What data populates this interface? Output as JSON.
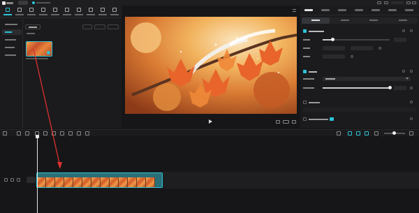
{
  "window": {
    "project_title": "",
    "app_logo_icon": "app-logo-icon",
    "menu_button_label": "",
    "autosave_status": ""
  },
  "media_toolbar": {
    "tools": [
      {
        "label": "",
        "icon": "media-icon",
        "active": true
      },
      {
        "label": "",
        "icon": "audio-icon"
      },
      {
        "label": "",
        "icon": "text-icon"
      },
      {
        "label": "",
        "icon": "sticker-icon"
      },
      {
        "label": "",
        "icon": "effects-icon"
      },
      {
        "label": "",
        "icon": "transition-icon"
      },
      {
        "label": "",
        "icon": "filter-icon"
      },
      {
        "label": "",
        "icon": "adjust-icon"
      },
      {
        "label": "",
        "icon": "template-icon"
      },
      {
        "label": "",
        "icon": "digital-human-icon"
      }
    ]
  },
  "media_sidebar": {
    "items": [
      {
        "label": "",
        "selected": false
      },
      {
        "label": "",
        "selected": true
      },
      {
        "label": "",
        "selected": false
      },
      {
        "label": "",
        "selected": false
      },
      {
        "label": "",
        "selected": false
      }
    ]
  },
  "media_content": {
    "import_label": "",
    "folder_label": "",
    "tools": [
      "",
      "",
      ""
    ],
    "items": [
      {
        "name": "",
        "has_badge": true
      }
    ]
  },
  "preview": {
    "title": "",
    "current_time": "",
    "total_time": "",
    "play_icon": "play-icon"
  },
  "properties": {
    "tabs": [
      {
        "label": "",
        "selected": true
      },
      {
        "label": ""
      },
      {
        "label": ""
      },
      {
        "label": ""
      },
      {
        "label": ""
      },
      {
        "label": ""
      },
      {
        "label": ""
      }
    ],
    "subtabs": [
      {
        "label": "",
        "selected": true
      },
      {
        "label": ""
      },
      {
        "label": ""
      },
      {
        "label": ""
      }
    ],
    "position_size": {
      "enabled": true,
      "scale_percent": "",
      "scale_level": 0.15,
      "x_value": "",
      "y_value": "",
      "rotation_value": ""
    },
    "blend": {
      "enabled": true,
      "mode_value": "",
      "opacity_percent": "",
      "opacity_level": 1.0
    },
    "stabilize": {
      "enabled": false
    },
    "smart_enhance": {
      "enabled": false
    }
  },
  "timeline": {
    "ruler_ticks": [
      "",
      "",
      "",
      "",
      "",
      "",
      "",
      "",
      ""
    ],
    "cover_label": "",
    "clip": {
      "label": "",
      "frame_count": 13
    }
  },
  "colors": {
    "accent": "#2bc3d6",
    "clip_border": "#2bc3d6",
    "annotation_arrow": "#e03030"
  }
}
